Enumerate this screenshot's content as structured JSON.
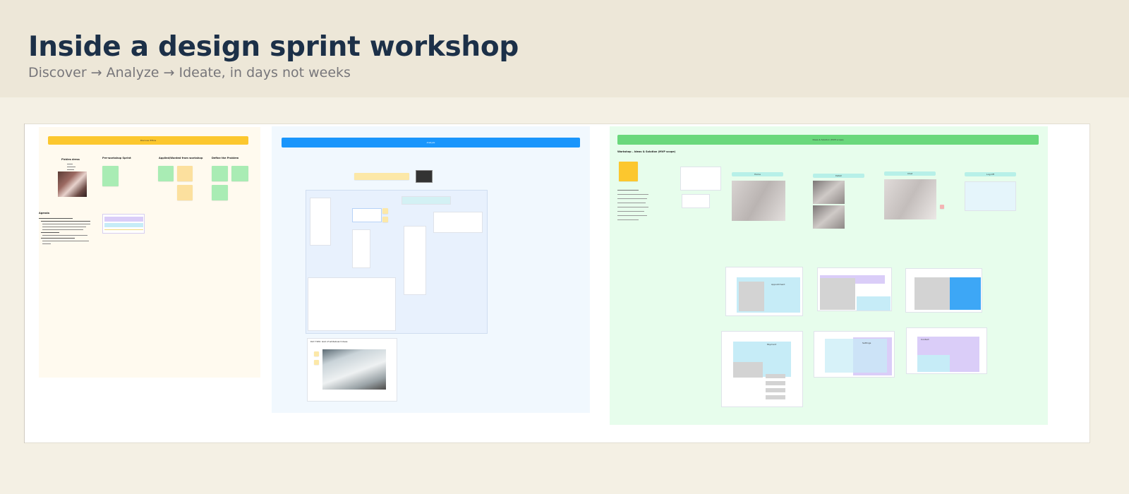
{
  "header": {
    "title": "Inside a design sprint workshop",
    "subtitle": "Discover → Analyze → Ideate, in days not weeks"
  },
  "colors": {
    "header_bg": "#ede7d8",
    "page_bg": "#f4f0e4",
    "title": "#1c3048",
    "subtitle": "#77767a",
    "discover_bar": "#fcc72e",
    "analyze_bar": "#1a96fc",
    "ideate_bar": "#6ad87c",
    "discover_bg": "#fffaef",
    "analyze_bg": "#f1f8fe",
    "ideate_bg": "#e7fdec"
  },
  "board": {
    "discover": {
      "bar_label": "Discover Ethos",
      "heading_research": "Pickles dress",
      "column_headings": [
        "Pre-workshop Sprint",
        "Applied/Wanted from workshop",
        "Define the Problem"
      ],
      "agenda_title": "Agenda"
    },
    "analyze": {
      "bar_label": "Analyze",
      "photo_caption": "DAY TWO: Gist of whiteboard ideas"
    },
    "ideate": {
      "bar_label": "Ideas & Solution (MVP scope)",
      "workshop_title": "Workshop – Ideas & Solution (MVP scope)",
      "column_labels": [
        "Home",
        "Detail",
        "Chat",
        "Log Off"
      ],
      "card_labels": [
        "Appointment",
        "Payment",
        "Settings",
        "Contact",
        "Overview"
      ]
    }
  }
}
